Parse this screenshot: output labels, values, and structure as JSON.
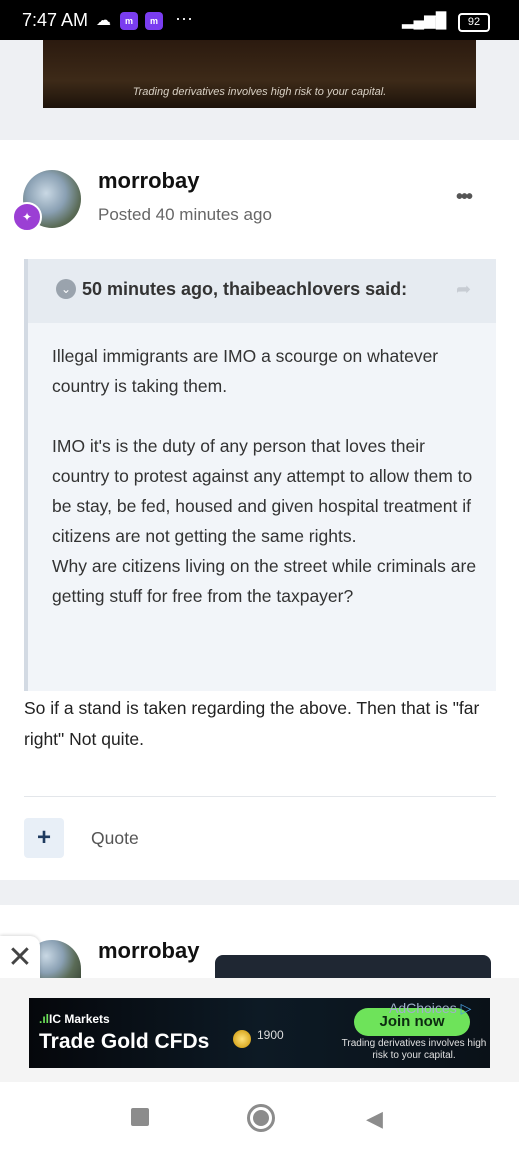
{
  "status_bar": {
    "time": "7:47 AM",
    "battery": "92",
    "more": "···"
  },
  "top_ad": {
    "disclaimer": "Trading derivatives involves high risk to your capital."
  },
  "post": {
    "author": "morrobay",
    "posted": "Posted 40 minutes ago",
    "menu_icon": "•••",
    "quote": {
      "header": "50 minutes ago, thaibeachlovers said:",
      "paragraphs": [
        "Illegal immigrants are IMO a scourge on whatever country is taking them.",
        "IMO it's is the duty of any person that loves their country to protest against any attempt to allow them to be stay, be fed, housed and given hospital treatment if citizens are not getting the same rights.",
        "Why are citizens living on the street while criminals are getting stuff for free from the taxpayer?"
      ]
    },
    "reply": "So if a stand is taken regarding the above. Then that is \"far right\"  Not quite.",
    "actions": {
      "plus": "+",
      "quote_label": "Quote"
    }
  },
  "next_post": {
    "author": "morrobay"
  },
  "bottom_ad": {
    "brand": "IC Markets",
    "headline": "Trade Gold CFDs",
    "price": "1900",
    "cta": "Join now",
    "adchoices": "AdChoices",
    "disclaimer": "Trading derivatives involves high risk to your capital."
  },
  "colors": {
    "rank_badge": "#9b3fd4",
    "cta": "#6ee35a",
    "quote_bg": "#f2f5f9"
  }
}
